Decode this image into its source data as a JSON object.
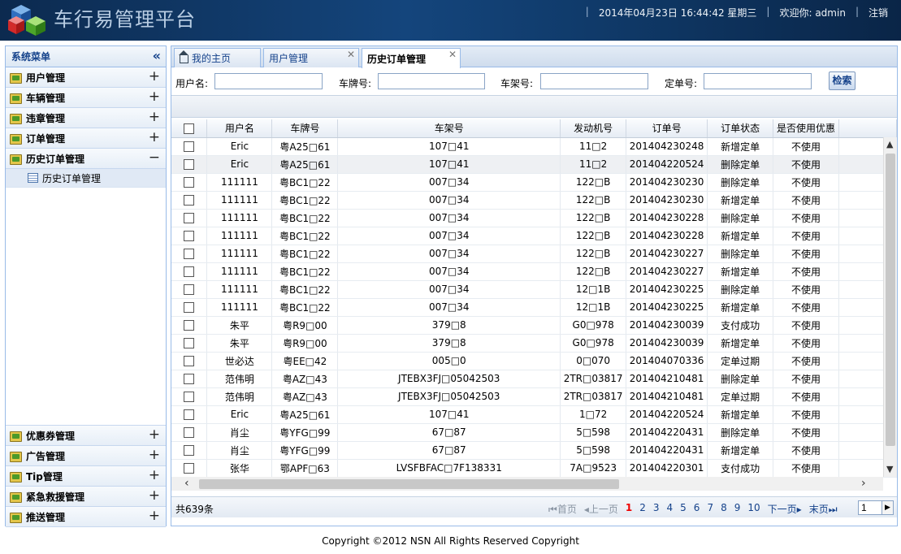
{
  "header": {
    "app_title": "车行易管理平台",
    "datetime": "2014年04月23日 16:44:42 星期三",
    "welcome": "欢迎你: admin",
    "logout": "注销"
  },
  "sidebar": {
    "title": "系统菜单",
    "collapse": "«",
    "items_top": [
      {
        "label": "用户管理",
        "toggle": "+"
      },
      {
        "label": "车辆管理",
        "toggle": "+"
      },
      {
        "label": "违章管理",
        "toggle": "+"
      },
      {
        "label": "订单管理",
        "toggle": "+"
      },
      {
        "label": "历史订单管理",
        "toggle": "−"
      }
    ],
    "sub_item": "历史订单管理",
    "items_bottom": [
      {
        "label": "优惠券管理",
        "toggle": "+"
      },
      {
        "label": "广告管理",
        "toggle": "+"
      },
      {
        "label": "Tip管理",
        "toggle": "+"
      },
      {
        "label": "紧急救援管理",
        "toggle": "+"
      },
      {
        "label": "推送管理",
        "toggle": "+"
      }
    ]
  },
  "tabs": [
    {
      "label": "我的主页",
      "closable": false
    },
    {
      "label": "用户管理",
      "closable": true
    },
    {
      "label": "历史订单管理",
      "closable": true
    }
  ],
  "search": {
    "username_label": "用户名:",
    "plate_label": "车牌号:",
    "frame_label": "车架号:",
    "order_label": "定单号:",
    "button": "检索"
  },
  "grid": {
    "columns": [
      "用户名",
      "车牌号",
      "车架号",
      "发动机号",
      "订单号",
      "订单状态",
      "是否使用优惠"
    ],
    "rows": [
      [
        "Eric",
        "粤A25□61",
        "107□41",
        "11□2",
        "201404230248",
        "新增定单",
        "不使用"
      ],
      [
        "Eric",
        "粤A25□61",
        "107□41",
        "11□2",
        "201404220524",
        "删除定单",
        "不使用"
      ],
      [
        "111111",
        "粤BC1□22",
        "007□34",
        "122□B",
        "201404230230",
        "删除定单",
        "不使用"
      ],
      [
        "111111",
        "粤BC1□22",
        "007□34",
        "122□B",
        "201404230230",
        "新增定单",
        "不使用"
      ],
      [
        "111111",
        "粤BC1□22",
        "007□34",
        "122□B",
        "201404230228",
        "删除定单",
        "不使用"
      ],
      [
        "111111",
        "粤BC1□22",
        "007□34",
        "122□B",
        "201404230228",
        "新增定单",
        "不使用"
      ],
      [
        "111111",
        "粤BC1□22",
        "007□34",
        "122□B",
        "201404230227",
        "删除定单",
        "不使用"
      ],
      [
        "111111",
        "粤BC1□22",
        "007□34",
        "122□B",
        "201404230227",
        "新增定单",
        "不使用"
      ],
      [
        "111111",
        "粤BC1□22",
        "007□34",
        "12□1B",
        "201404230225",
        "删除定单",
        "不使用"
      ],
      [
        "111111",
        "粤BC1□22",
        "007□34",
        "12□1B",
        "201404230225",
        "新增定单",
        "不使用"
      ],
      [
        "朱平",
        "粤R9□00",
        "379□8",
        "G0□978",
        "201404230039",
        "支付成功",
        "不使用"
      ],
      [
        "朱平",
        "粤R9□00",
        "379□8",
        "G0□978",
        "201404230039",
        "新增定单",
        "不使用"
      ],
      [
        "世必达",
        "粤EE□42",
        "005□0",
        "0□070",
        "201404070336",
        "定单过期",
        "不使用"
      ],
      [
        "范伟明",
        "粤AZ□43",
        "JTEBX3FJ□05042503",
        "2TR□03817",
        "201404210481",
        "删除定单",
        "不使用"
      ],
      [
        "范伟明",
        "粤AZ□43",
        "JTEBX3FJ□05042503",
        "2TR□03817",
        "201404210481",
        "定单过期",
        "不使用"
      ],
      [
        "Eric",
        "粤A25□61",
        "107□41",
        "1□72",
        "201404220524",
        "新增定单",
        "不使用"
      ],
      [
        "肖尘",
        "粤YFG□99",
        "67□87",
        "5□598",
        "201404220431",
        "删除定单",
        "不使用"
      ],
      [
        "肖尘",
        "粤YFG□99",
        "67□87",
        "5□598",
        "201404220431",
        "新增定单",
        "不使用"
      ],
      [
        "张华",
        "鄂APF□63",
        "LVSFBFAC□7F138331",
        "7A□9523",
        "201404220301",
        "支付成功",
        "不使用"
      ]
    ]
  },
  "pager": {
    "total": "共639条",
    "first": "首页",
    "prev": "上一页",
    "pages": [
      "1",
      "2",
      "3",
      "4",
      "5",
      "6",
      "7",
      "8",
      "9",
      "10"
    ],
    "current": "1",
    "next": "下一页",
    "last": "末页",
    "input_value": "1"
  },
  "footer": "Copyright ©2012 NSN All Rights Reserved Copyright"
}
